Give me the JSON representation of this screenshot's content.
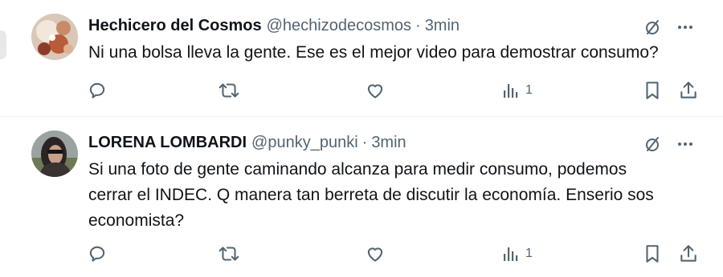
{
  "tweets": [
    {
      "display_name": "Hechicero del Cosmos",
      "handle": "@hechizodecosmos",
      "separator": "·",
      "time": "3min",
      "text_lines": [
        "Ni una bolsa lleva la gente. Ese es el mejor video para demostrar consumo?"
      ],
      "views_count": "1",
      "icons": {
        "grok": "grok-icon",
        "more": "more-options-icon",
        "reply": "reply-icon",
        "retweet": "retweet-icon",
        "like": "heart-icon",
        "views": "views-icon",
        "bookmark": "bookmark-icon",
        "share": "share-icon"
      }
    },
    {
      "display_name": "LORENA LOMBARDI",
      "handle": "@punky_punki",
      "separator": "·",
      "time": "3min",
      "text_lines": [
        "Si una foto de gente caminando alcanza para medir consumo, podemos",
        "cerrar el INDEC. Q manera tan berreta de discutir la economía. Enserio sos",
        "economista?"
      ],
      "views_count": "1",
      "icons": {
        "grok": "grok-icon",
        "more": "more-options-icon",
        "reply": "reply-icon",
        "retweet": "retweet-icon",
        "like": "heart-icon",
        "views": "views-icon",
        "bookmark": "bookmark-icon",
        "share": "share-icon"
      }
    }
  ],
  "colors": {
    "text_primary": "#0f1419",
    "text_secondary": "#536471",
    "divider": "#eff3f4",
    "background": "#ffffff"
  }
}
